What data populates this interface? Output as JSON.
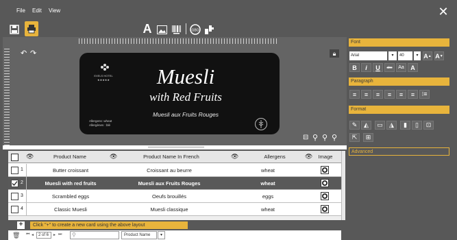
{
  "menu": {
    "file": "File",
    "edit": "Edit",
    "view": "View",
    "close": "✕"
  },
  "card": {
    "title": "Muesli",
    "subtitle": "with Red Fruits",
    "french": "Muesli aux Fruits Rouges",
    "hotel_name": "EXELS HOTEL",
    "hotel_stars": "★★★★★",
    "allergens_line1": "Allergens: wheat",
    "allergens_line2": "Allergènes : blé",
    "background": "#111111"
  },
  "panel": {
    "font_header": "Font",
    "font_name": "Arial",
    "font_size": "40",
    "paragraph_header": "Paragraph",
    "format_header": "Format",
    "advanced_header": "Advanced",
    "font_buttons": [
      "A",
      "A"
    ],
    "style_buttons": [
      "B",
      "i",
      "U",
      "abc",
      "Aa",
      "A"
    ]
  },
  "grid": {
    "headers": [
      "Product Name",
      "Product Name In French",
      "Allergens",
      "Image"
    ],
    "rows": [
      {
        "num": "1",
        "name": "Butter croissant",
        "french": "Croissant au beurre",
        "allergens": "wheat",
        "checked": false,
        "selected": false
      },
      {
        "num": "2",
        "name": "Muesli with red fruits",
        "french": "Muesli aux Fruits Rouges",
        "allergens": "wheat",
        "checked": true,
        "selected": true
      },
      {
        "num": "3",
        "name": "Scrambled eggs",
        "french": "Oeufs brouillés",
        "allergens": "eggs",
        "checked": false,
        "selected": false
      },
      {
        "num": "4",
        "name": "Classic Muesli",
        "french": "Muesli classique",
        "allergens": "wheat",
        "checked": false,
        "selected": false
      }
    ]
  },
  "status": {
    "add_hint": "Click \"+\" to create a new card using the above layout",
    "plus": "+"
  },
  "pager": {
    "page_text": "2 of 6",
    "filter_field": "Product Name"
  },
  "colors": {
    "accent": "#e8b43c",
    "selected_row": "#595959",
    "header_bg": "#e6e6e6"
  }
}
